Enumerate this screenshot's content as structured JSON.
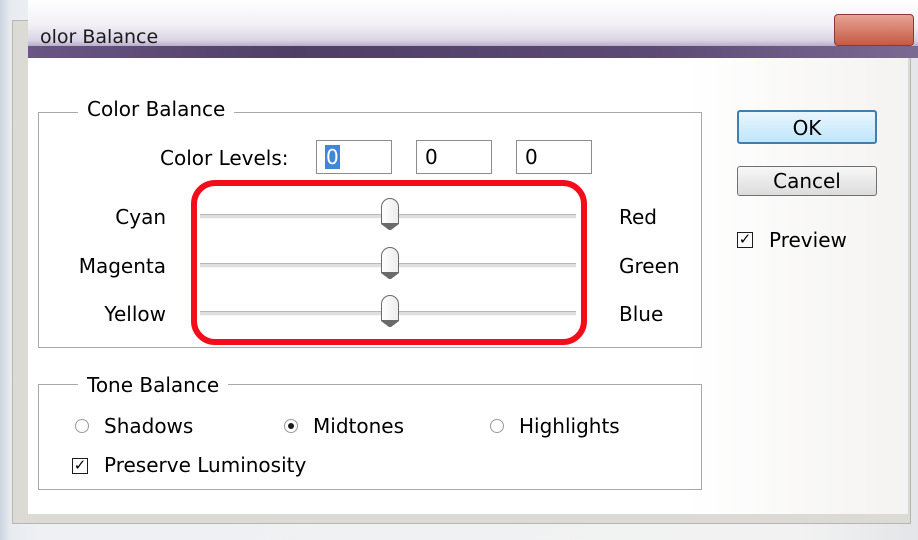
{
  "window": {
    "title": "olor Balance"
  },
  "color_balance": {
    "group_title": "Color Balance",
    "levels_label": "Color Levels:",
    "levels": [
      "0",
      "0",
      "0"
    ],
    "sliders": [
      {
        "left_label": "Cyan",
        "right_label": "Red",
        "value": 0
      },
      {
        "left_label": "Magenta",
        "right_label": "Green",
        "value": 0
      },
      {
        "left_label": "Yellow",
        "right_label": "Blue",
        "value": 0
      }
    ]
  },
  "tone_balance": {
    "group_title": "Tone Balance",
    "options": [
      "Shadows",
      "Midtones",
      "Highlights"
    ],
    "selected": "Midtones",
    "preserve_luminosity_label": "Preserve Luminosity",
    "preserve_luminosity": true
  },
  "buttons": {
    "ok": "OK",
    "cancel": "Cancel"
  },
  "preview": {
    "label": "Preview",
    "checked": true
  },
  "check_mark": "✓",
  "colors": {
    "highlight": "#f20d1a",
    "selection": "#3f88d9"
  }
}
